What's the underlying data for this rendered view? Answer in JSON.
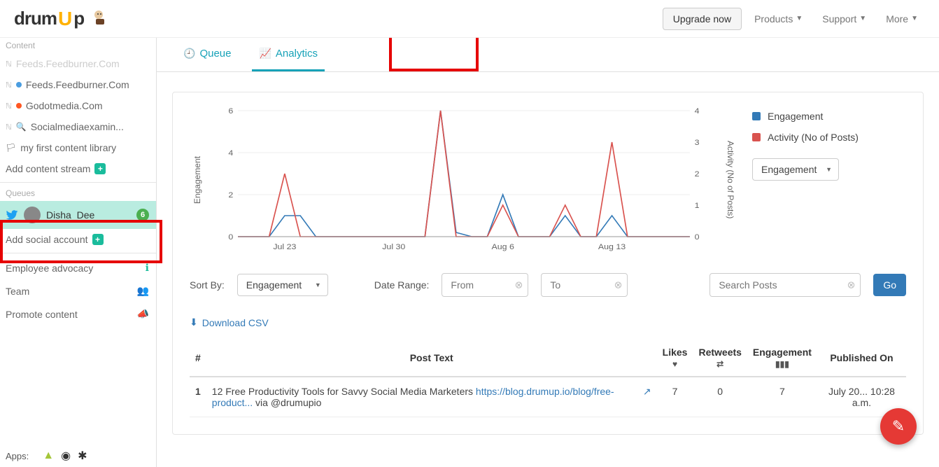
{
  "header": {
    "logo_text1": "drum",
    "logo_text2": "U",
    "logo_text3": "p",
    "upgrade": "Upgrade now",
    "nav": [
      "Products",
      "Support",
      "More"
    ]
  },
  "sidebar": {
    "content_label": "Content",
    "feeds": [
      {
        "text": "Feeds.Feedburner.Com",
        "faded": true,
        "dot": null
      },
      {
        "text": "Feeds.Feedburner.Com",
        "dot": "blue"
      },
      {
        "text": "Godotmedia.Com",
        "dot": "orange"
      },
      {
        "text": "Socialmediaexamin...",
        "icon": "magnify"
      },
      {
        "text": "my first content library",
        "icon": "flag"
      }
    ],
    "add_stream": "Add content stream",
    "queues_label": "Queues",
    "queue_name": "Disha_Dee",
    "queue_badge": "6",
    "add_social": "Add social account",
    "links": [
      {
        "text": "Employee advocacy",
        "icon": "info"
      },
      {
        "text": "Team",
        "icon": "users"
      },
      {
        "text": "Promote content",
        "icon": "megaphone"
      }
    ],
    "apps_label": "Apps:"
  },
  "tabs": {
    "queue": "Queue",
    "analytics": "Analytics"
  },
  "chart_data": {
    "type": "line",
    "x_ticks": [
      "Jul 23",
      "Jul 30",
      "Aug 6",
      "Aug 13"
    ],
    "y_left_label": "Engagement",
    "y_left_ticks": [
      0,
      2,
      4,
      6
    ],
    "y_right_label": "Activity (No of Posts)",
    "y_right_ticks": [
      0,
      1,
      2,
      3,
      4
    ],
    "series": [
      {
        "name": "Engagement",
        "color": "#337ab7",
        "axis": "left",
        "x": [
          0,
          1,
          2,
          3,
          4,
          5,
          6,
          7,
          8,
          9,
          10,
          11,
          12,
          13,
          14,
          15,
          16,
          17,
          18,
          19,
          20,
          21,
          22,
          23,
          24,
          25,
          26,
          27,
          28,
          29
        ],
        "y": [
          0,
          0,
          0,
          1,
          1,
          0,
          0,
          0,
          0,
          0,
          0,
          0,
          0,
          6,
          0.2,
          0,
          0,
          2,
          0,
          0,
          0,
          1,
          0,
          0,
          1,
          0,
          0,
          0,
          0,
          0
        ]
      },
      {
        "name": "Activity (No of Posts)",
        "color": "#d9534f",
        "axis": "right",
        "x": [
          0,
          1,
          2,
          3,
          4,
          5,
          6,
          7,
          8,
          9,
          10,
          11,
          12,
          13,
          14,
          15,
          16,
          17,
          18,
          19,
          20,
          21,
          22,
          23,
          24,
          25,
          26,
          27,
          28,
          29
        ],
        "y": [
          0,
          0,
          0,
          2,
          0,
          0,
          0,
          0,
          0,
          0,
          0,
          0,
          0,
          4,
          0,
          0,
          0,
          1,
          0,
          0,
          0,
          1,
          0,
          0,
          3,
          0,
          0,
          0,
          0,
          0
        ]
      }
    ],
    "legend": [
      "Engagement",
      "Activity (No of Posts)"
    ]
  },
  "controls": {
    "metric_select": "Engagement",
    "sort_by_label": "Sort By:",
    "sort_by_value": "Engagement",
    "date_range_label": "Date Range:",
    "from_placeholder": "From",
    "to_placeholder": "To",
    "search_placeholder": "Search Posts",
    "go": "Go",
    "download": "Download CSV"
  },
  "table": {
    "headers": {
      "idx": "#",
      "post": "Post Text",
      "likes": "Likes",
      "retweets": "Retweets",
      "engagement": "Engagement",
      "published": "Published On"
    },
    "rows": [
      {
        "idx": "1",
        "text_prefix": "12 Free Productivity Tools for Savvy Social Media Marketers ",
        "link": "https://blog.drumup.io/blog/free-product...",
        "text_suffix": "via @drumupio",
        "likes": "7",
        "retweets": "0",
        "engagement": "7",
        "published": "July 20... 10:28 a.m."
      }
    ]
  }
}
